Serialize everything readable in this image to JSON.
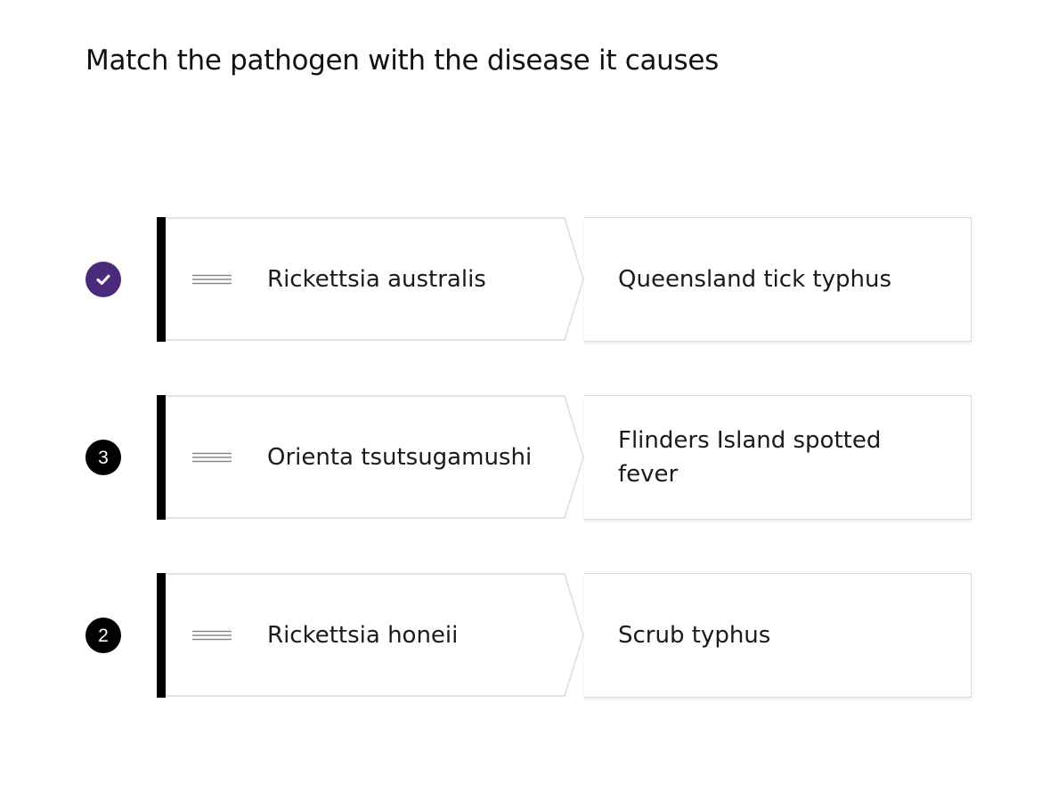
{
  "question": {
    "title": "Match the pathogen with the disease it causes"
  },
  "rows": [
    {
      "status": "correct",
      "status_label": "",
      "pathogen": "Rickettsia australis",
      "disease": "Queensland tick typhus"
    },
    {
      "status": "number",
      "status_label": "3",
      "pathogen": "Orienta tsutsugamushi",
      "disease": "Flinders Island spotted fever"
    },
    {
      "status": "number",
      "status_label": "2",
      "pathogen": "Rickettsia honeii",
      "disease": "Scrub typhus"
    }
  ],
  "icons": {
    "correct": "check-icon",
    "handle": "drag-handle-icon"
  },
  "colors": {
    "correct": "#4b2a7b",
    "number": "#000000",
    "accent_bar": "#000000",
    "border": "#dcdcdc"
  }
}
